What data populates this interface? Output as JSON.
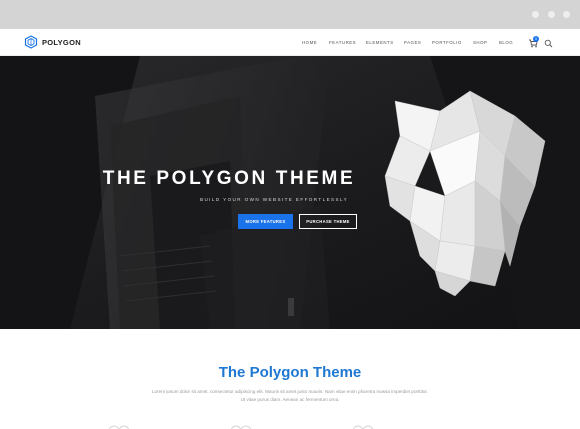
{
  "brand": {
    "name": "POLYGON",
    "accent": "#1a73e8"
  },
  "nav": {
    "items": [
      {
        "label": "HOME"
      },
      {
        "label": "FEATURES"
      },
      {
        "label": "ELEMENTS"
      },
      {
        "label": "PAGES"
      },
      {
        "label": "PORTFOLIO"
      },
      {
        "label": "SHOP"
      },
      {
        "label": "BLOG"
      }
    ],
    "cart_count": "0",
    "icons": [
      "cart-icon",
      "search-icon"
    ]
  },
  "hero": {
    "title": "THE POLYGON THEME",
    "subtitle": "BUILD YOUR OWN WEBSITE EFFORTLESSLY",
    "primary_button": "MORE FEATURES",
    "secondary_button": "PURCHASE THEME"
  },
  "intro": {
    "title": "The Polygon Theme",
    "text": "Lorem ipsum dolor sit amet, consectetur adipiscing elit. Mauris sit amet justo mauris. Nam vitae enim pharetra massa imperdiet porttitor. Ut vitae purus diam. Aenean ac fermentum urna."
  }
}
